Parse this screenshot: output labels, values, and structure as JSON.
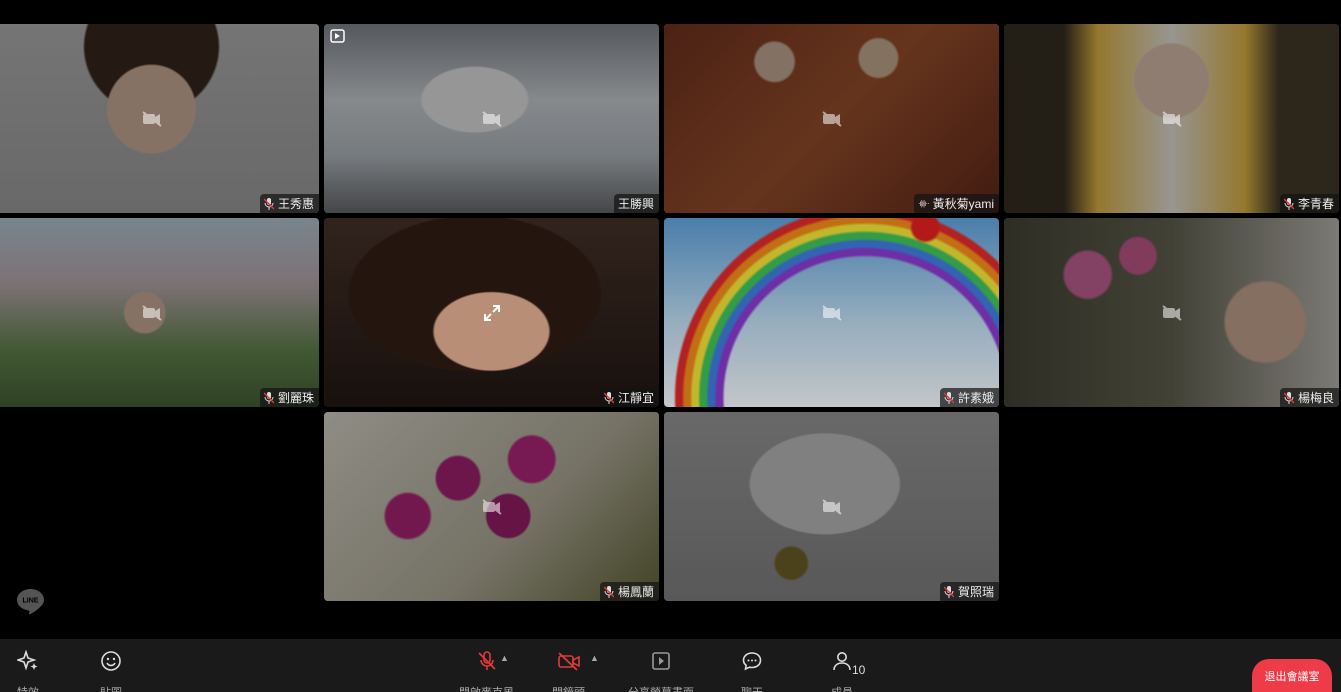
{
  "participants": [
    {
      "name": "王秀惠",
      "camera": "off",
      "muted": true
    },
    {
      "name": "王勝興",
      "camera": "off",
      "muted": false
    },
    {
      "name": "黃秋菊yami",
      "camera": "off",
      "muted": false,
      "speaking": true
    },
    {
      "name": "李青春",
      "camera": "off",
      "muted": true
    },
    {
      "name": "劉麗珠",
      "camera": "off",
      "muted": true
    },
    {
      "name": "江靜宜",
      "camera": "on",
      "muted": true
    },
    {
      "name": "許素娥",
      "camera": "off",
      "muted": true
    },
    {
      "name": "楊梅良",
      "camera": "off",
      "muted": true
    },
    {
      "name": "楊鳳蘭",
      "camera": "off",
      "muted": true
    },
    {
      "name": "賀照瑞",
      "camera": "off",
      "muted": true
    }
  ],
  "watermark": "LINE",
  "toolbar": {
    "effects_label": "特效",
    "stickers_label": "貼圖",
    "mic_label": "開啟麥克風",
    "camera_label": "開鏡頭",
    "share_label": "分享螢幕畫面",
    "chat_label": "聊天",
    "members_label": "成員",
    "members_count": "10",
    "leave_label": "退出會議室"
  },
  "colors": {
    "active_speaker": "#37c24a",
    "leave_button": "#ef3b47",
    "muted_mic": "#e03a3a"
  }
}
